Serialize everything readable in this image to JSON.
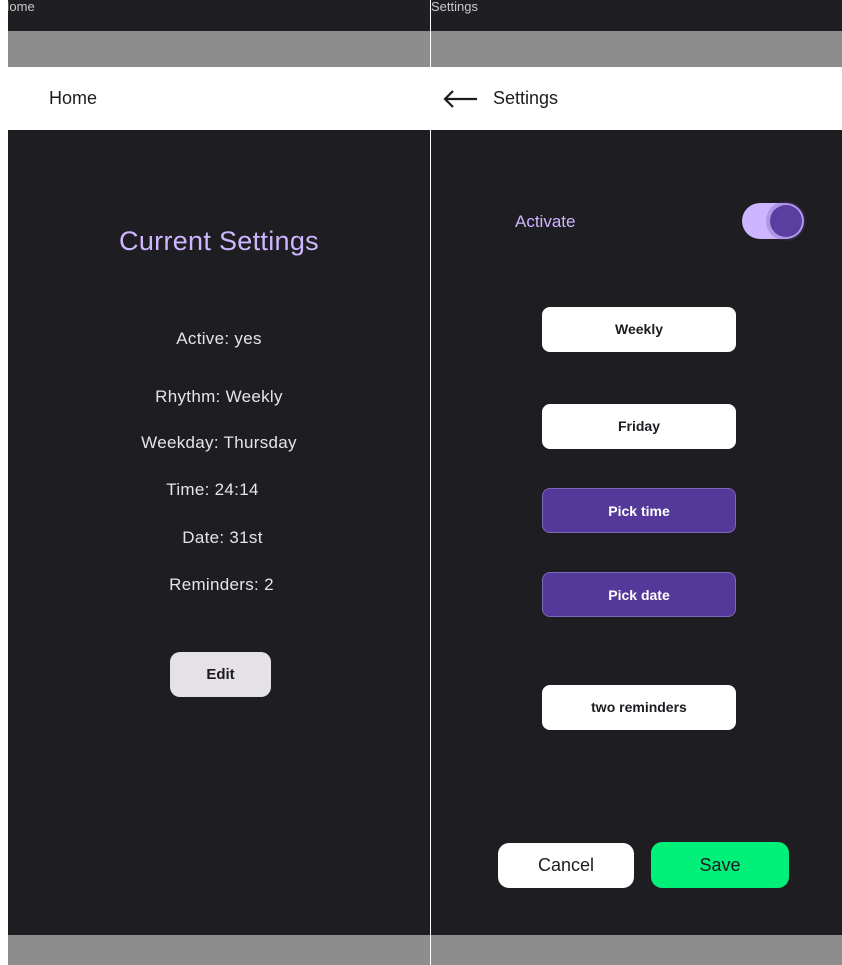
{
  "home_frame": {
    "frame_label": "Home",
    "app_bar_title": "Home",
    "title": "Current Settings",
    "lines": {
      "active": "Active: yes",
      "rhythm": "Rhythm: Weekly",
      "weekday": "Weekday: Thursday",
      "time": "Time: 24:14",
      "date": "Date: 31st",
      "reminders": "Reminders: 2"
    },
    "edit_label": "Edit"
  },
  "settings_frame": {
    "frame_label": "Settings",
    "app_bar_title": "Settings",
    "activate_label": "Activate",
    "activate_on": true,
    "rhythm_value": "Weekly",
    "weekday_value": "Friday",
    "pick_time_label": "Pick time",
    "pick_date_label": "Pick date",
    "reminders_value": "two reminders",
    "cancel_label": "Cancel",
    "save_label": "Save"
  },
  "colors": {
    "background": "#1e1d21",
    "accent": "#cdb6ff",
    "primary": "#55399a",
    "save": "#00f07a",
    "bars": "#8d8d8d"
  }
}
